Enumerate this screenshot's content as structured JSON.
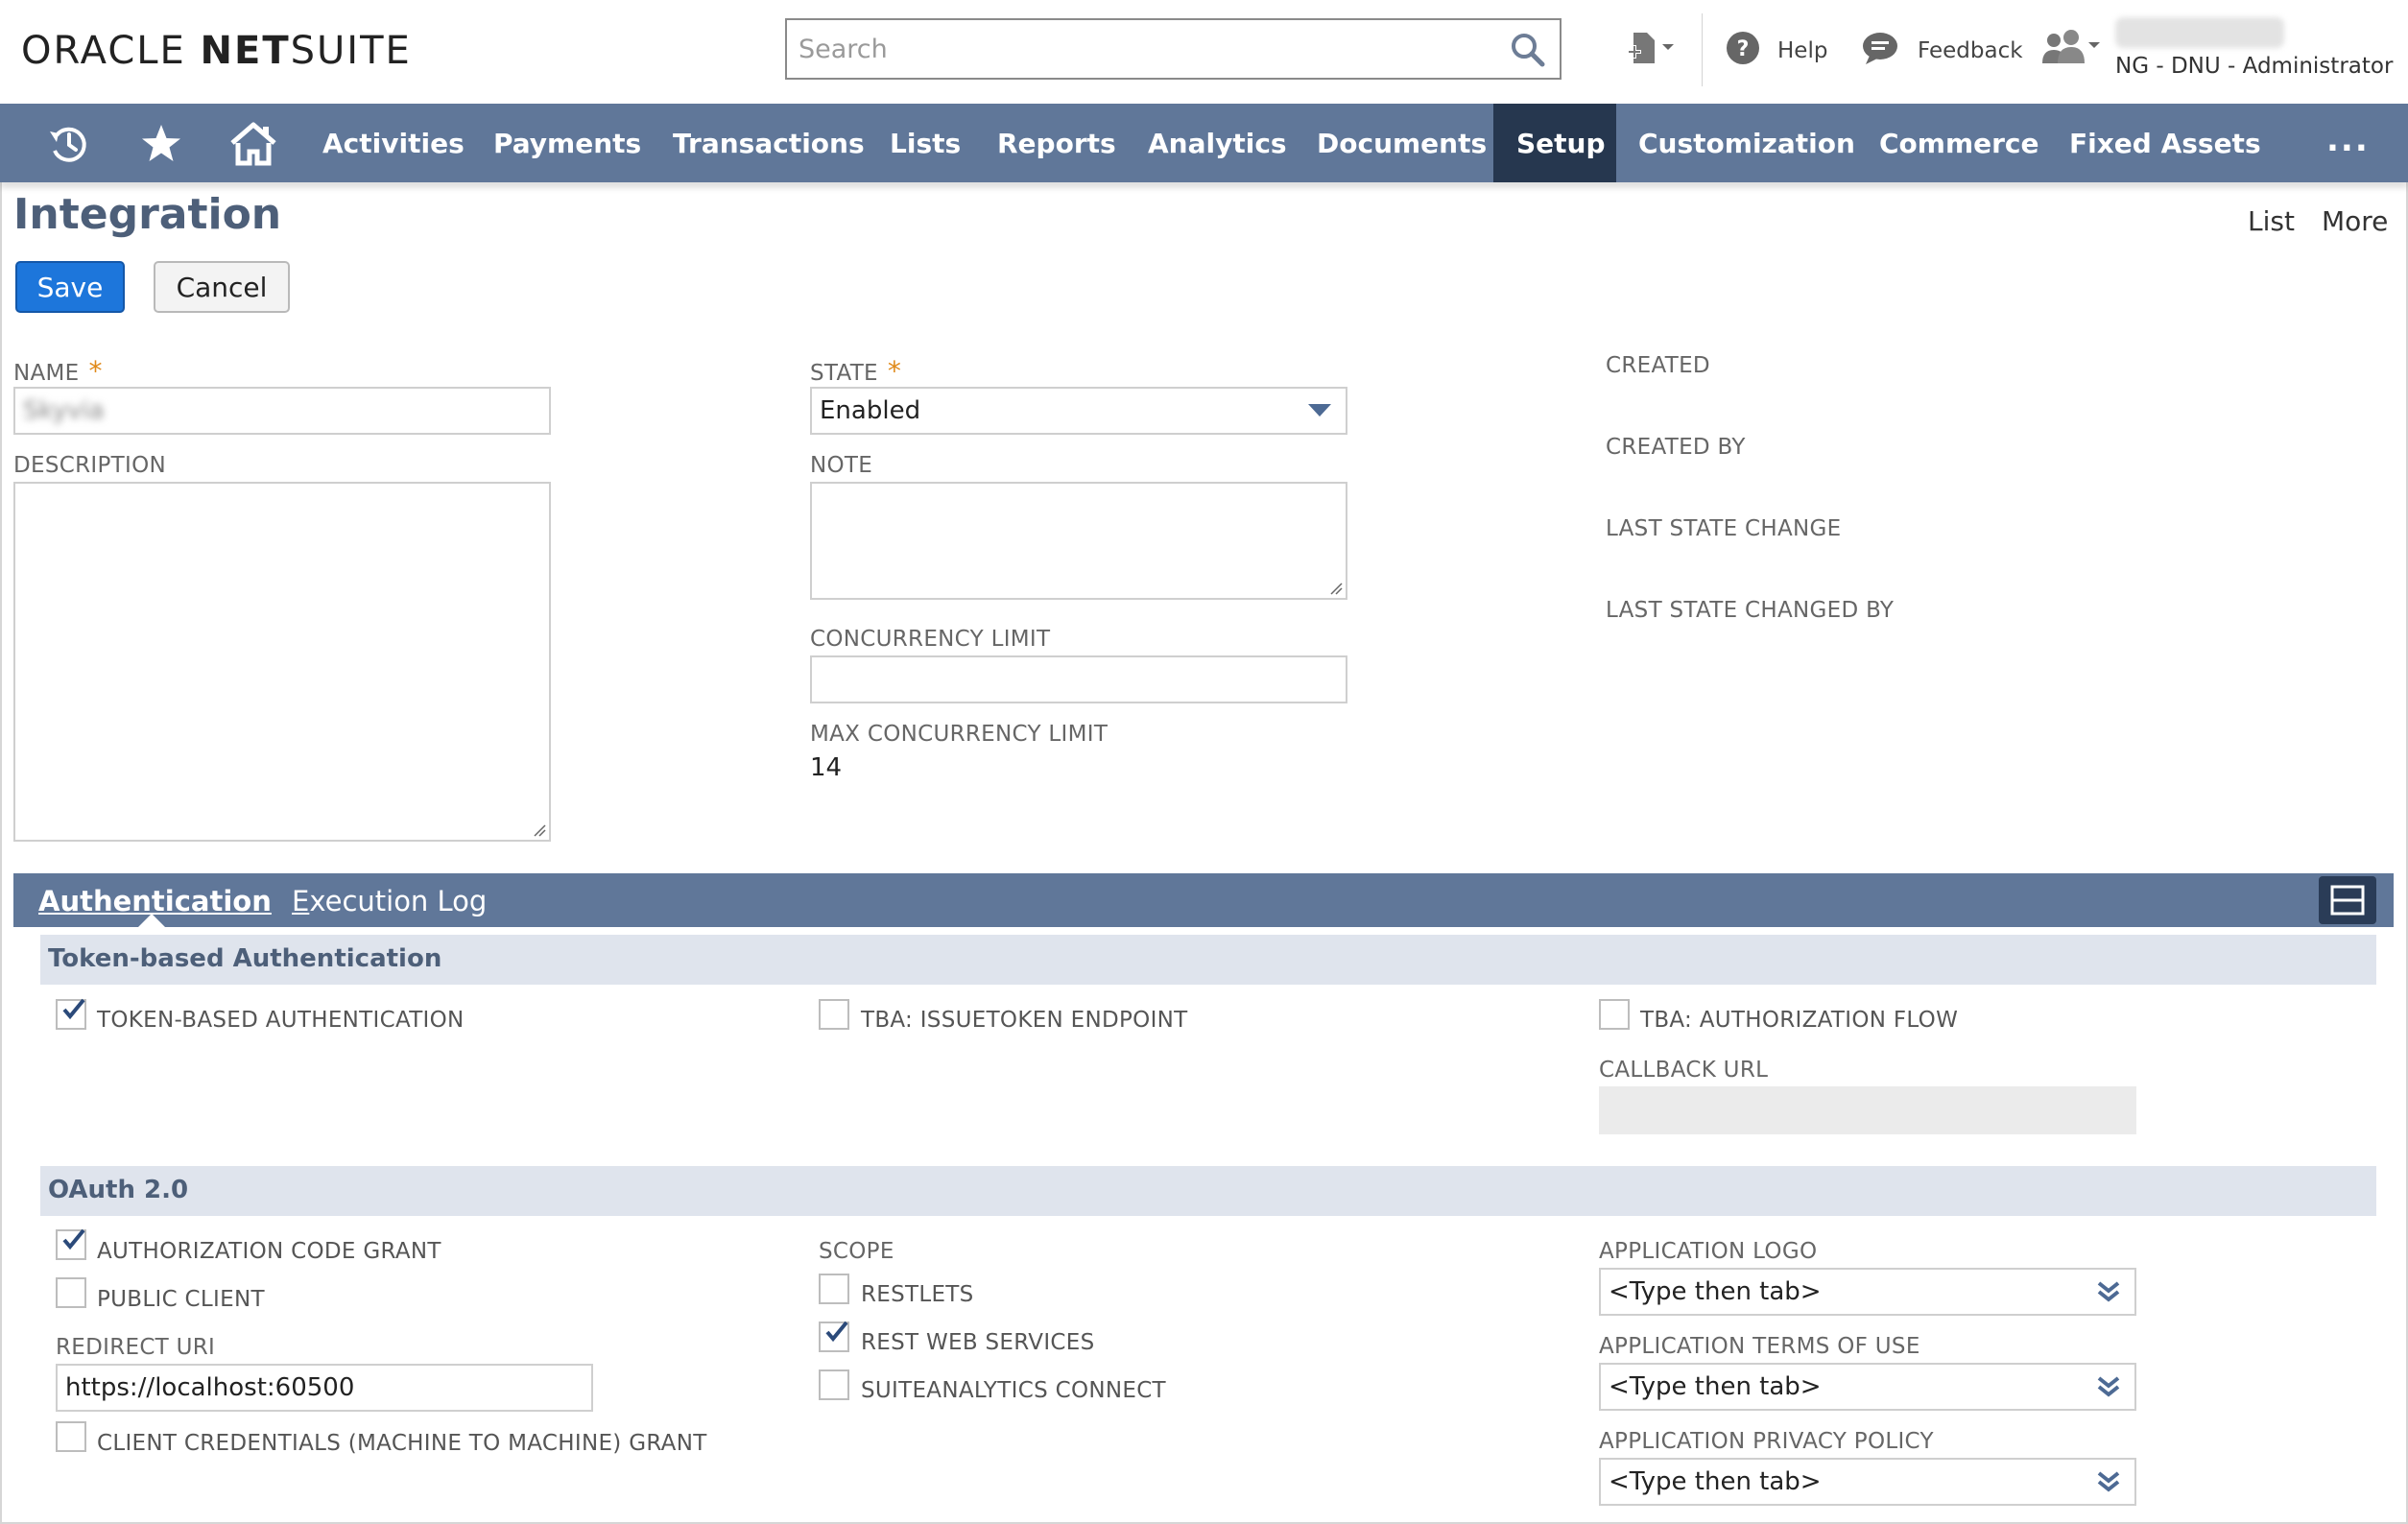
{
  "header": {
    "logo": {
      "oracle": "ORACLE",
      "net": "NET",
      "suite": "SUITE"
    },
    "search_placeholder": "Search",
    "help_label": "Help",
    "feedback_label": "Feedback",
    "user_role": "NG - DNU - Administrator"
  },
  "nav": {
    "items": [
      {
        "label": "Activities"
      },
      {
        "label": "Payments"
      },
      {
        "label": "Transactions"
      },
      {
        "label": "Lists"
      },
      {
        "label": "Reports"
      },
      {
        "label": "Analytics"
      },
      {
        "label": "Documents"
      },
      {
        "label": "Setup",
        "active": true
      },
      {
        "label": "Customization"
      },
      {
        "label": "Commerce"
      },
      {
        "label": "Fixed Assets"
      }
    ],
    "more": "..."
  },
  "page": {
    "title": "Integration",
    "list_link": "List",
    "more_link": "More",
    "save_label": "Save",
    "cancel_label": "Cancel"
  },
  "form": {
    "name_label": "NAME",
    "name_value": "Skyvia",
    "description_label": "DESCRIPTION",
    "state_label": "STATE",
    "state_value": "Enabled",
    "note_label": "NOTE",
    "concurrency_label": "CONCURRENCY LIMIT",
    "max_concurrency_label": "MAX CONCURRENCY LIMIT",
    "max_concurrency_value": "14",
    "created_label": "CREATED",
    "created_by_label": "CREATED BY",
    "last_state_change_label": "LAST STATE CHANGE",
    "last_state_changed_by_label": "LAST STATE CHANGED BY",
    "required_mark": "*"
  },
  "tabs": {
    "authentication": "Authentication",
    "execution_log_first": "E",
    "execution_log_rest": "xecution Log"
  },
  "tba": {
    "section_title": "Token-based Authentication",
    "token_based_auth": "TOKEN-BASED AUTHENTICATION",
    "token_based_auth_checked": true,
    "issuetoken_endpoint": "TBA: ISSUETOKEN ENDPOINT",
    "issuetoken_endpoint_checked": false,
    "authorization_flow": "TBA: AUTHORIZATION FLOW",
    "authorization_flow_checked": false,
    "callback_url_label": "CALLBACK URL"
  },
  "oauth": {
    "section_title": "OAuth 2.0",
    "auth_code_grant": "AUTHORIZATION CODE GRANT",
    "auth_code_grant_checked": true,
    "public_client": "PUBLIC CLIENT",
    "public_client_checked": false,
    "redirect_uri_label": "REDIRECT URI",
    "redirect_uri_value": "https://localhost:60500",
    "client_credentials": "CLIENT CREDENTIALS (MACHINE TO MACHINE) GRANT",
    "client_credentials_checked": false,
    "scope_label": "SCOPE",
    "restlets": "RESTLETS",
    "restlets_checked": false,
    "rest_web_services": "REST WEB SERVICES",
    "rest_web_services_checked": true,
    "suiteanalytics_connect": "SUITEANALYTICS CONNECT",
    "suiteanalytics_connect_checked": false,
    "app_logo_label": "APPLICATION LOGO",
    "app_logo_value": "<Type then tab>",
    "app_terms_label": "APPLICATION TERMS OF USE",
    "app_terms_value": "<Type then tab>",
    "app_privacy_label": "APPLICATION PRIVACY POLICY",
    "app_privacy_value": "<Type then tab>"
  },
  "colors": {
    "nav_bg": "#607799",
    "nav_active": "#26374f",
    "primary_button": "#1d76db",
    "section_bg": "#dfe4ed",
    "required_star": "#e08a1a"
  }
}
